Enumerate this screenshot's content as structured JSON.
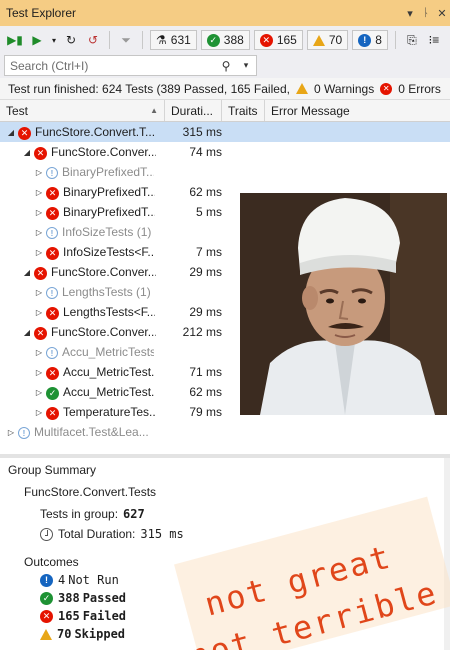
{
  "window": {
    "title": "Test Explorer",
    "controls": [
      "▾",
      "ᚿ",
      "✕"
    ]
  },
  "toolbar": {
    "counts": {
      "total": "631",
      "passed": "388",
      "failed": "165",
      "warnings": "70",
      "not_run": "8"
    }
  },
  "search": {
    "placeholder": "Search (Ctrl+I)"
  },
  "status": {
    "summary": "Test run finished: 624 Tests (389 Passed, 165 Failed,",
    "warnings": "0 Warnings",
    "errors": "0 Errors"
  },
  "columns": [
    "Test",
    "Durati...",
    "Traits",
    "Error Message"
  ],
  "tree": [
    {
      "name": "FuncStore.Convert.T...",
      "duration": "315 ms",
      "status": "failed",
      "level": 0,
      "expanded": true,
      "selected": true
    },
    {
      "name": "FuncStore.Conver...",
      "duration": "74 ms",
      "status": "failed",
      "level": 1,
      "expanded": true
    },
    {
      "name": "BinaryPrefixedT...",
      "duration": "",
      "status": "notrun",
      "level": 2
    },
    {
      "name": "BinaryPrefixedT...",
      "duration": "62 ms",
      "status": "failed",
      "level": 2
    },
    {
      "name": "BinaryPrefixedT...",
      "duration": "5 ms",
      "status": "failed",
      "level": 2
    },
    {
      "name": "InfoSizeTests  (1)",
      "duration": "",
      "status": "notrun",
      "level": 2
    },
    {
      "name": "InfoSizeTests<F...",
      "duration": "7 ms",
      "status": "failed",
      "level": 2
    },
    {
      "name": "FuncStore.Conver...",
      "duration": "29 ms",
      "status": "failed",
      "level": 1,
      "expanded": true
    },
    {
      "name": "LengthsTests  (1)",
      "duration": "",
      "status": "notrun",
      "level": 2
    },
    {
      "name": "LengthsTests<F...",
      "duration": "29 ms",
      "status": "failed",
      "level": 2
    },
    {
      "name": "FuncStore.Conver...",
      "duration": "212 ms",
      "status": "failed",
      "level": 1,
      "expanded": true
    },
    {
      "name": "Accu_MetricTests",
      "duration": "",
      "status": "notrun",
      "level": 2
    },
    {
      "name": "Accu_MetricTest...",
      "duration": "71 ms",
      "status": "failed",
      "level": 2
    },
    {
      "name": "Accu_MetricTest...",
      "duration": "62 ms",
      "status": "passed",
      "level": 2
    },
    {
      "name": "TemperatureTes...",
      "duration": "79 ms",
      "status": "failed",
      "level": 2
    },
    {
      "name": "Multifacet.Test&Lea...",
      "duration": "",
      "status": "notrun",
      "level": 0
    }
  ],
  "summary": {
    "header": "Group Summary",
    "group_name": "FuncStore.Convert.Tests",
    "tests_in_group_label": "Tests in group:",
    "tests_in_group": "627",
    "duration_label": "Total Duration:",
    "duration": "315 ms",
    "outcomes_label": "Outcomes",
    "outcomes": [
      {
        "count": "4",
        "label": "Not Run",
        "kind": "info"
      },
      {
        "count": "388",
        "label": "Passed",
        "kind": "pass"
      },
      {
        "count": "165",
        "label": "Failed",
        "kind": "fail"
      },
      {
        "count": "70",
        "label": "Skipped",
        "kind": "warn"
      }
    ]
  },
  "meme": {
    "line1": "not great",
    "line2": "not terrible"
  },
  "colors": {
    "accent_title": "#f5cc84",
    "pass": "#1e9234",
    "fail": "#e51400",
    "info": "#1565c0",
    "warn": "#e8a617",
    "selection": "#c9def5",
    "meme_text": "#e0461a"
  }
}
